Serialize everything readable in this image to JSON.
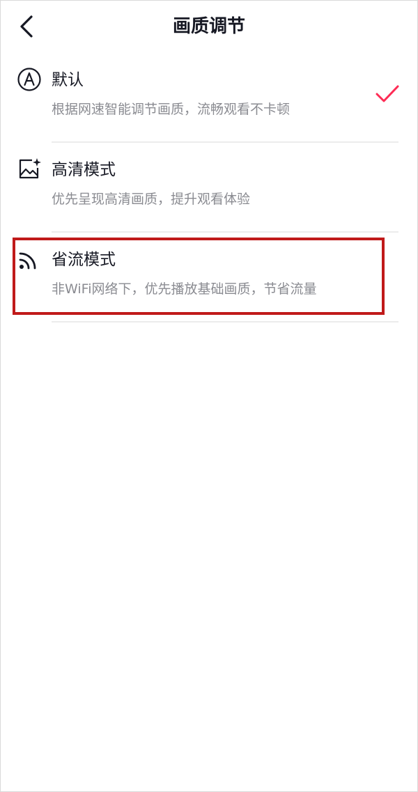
{
  "header": {
    "back_icon": "chevron-left-icon",
    "title": "画质调节"
  },
  "options": [
    {
      "icon": "auto-icon",
      "title": "默认",
      "description": "根据网速智能调节画质，流畅观看不卡顿",
      "selected": true
    },
    {
      "icon": "image-sparkle-icon",
      "title": "高清模式",
      "description": "优先呈现高清画质，提升观看体验",
      "selected": false
    },
    {
      "icon": "signal-icon",
      "title": "省流模式",
      "description": "非WiFi网络下，优先播放基础画质，节省流量",
      "selected": false
    }
  ],
  "colors": {
    "check": "#fe2c55",
    "highlight": "#c01a1a",
    "text_primary": "#161823",
    "text_secondary": "#8a8b91"
  }
}
